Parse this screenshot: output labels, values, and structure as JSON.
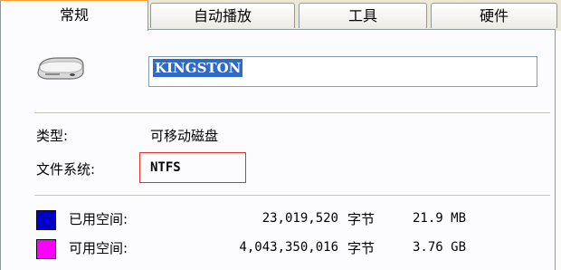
{
  "tabs": [
    {
      "label": "常规",
      "active": true
    },
    {
      "label": "自动播放",
      "active": false
    },
    {
      "label": "工具",
      "active": false
    },
    {
      "label": "硬件",
      "active": false
    }
  ],
  "drive": {
    "icon": "removable-drive-icon",
    "name": "KINGSTON"
  },
  "properties": {
    "type_label": "类型:",
    "type_value": "可移动磁盘",
    "filesystem_label": "文件系统:",
    "filesystem_value": "NTFS"
  },
  "space": {
    "used": {
      "label": "已用空间:",
      "bytes": "23,019,520",
      "unit": "字节",
      "size": "21.9 MB",
      "color": "#0000c8"
    },
    "free": {
      "label": "可用空间:",
      "bytes": "4,043,350,016",
      "unit": "字节",
      "size": "3.76 GB",
      "color": "#ff00ff"
    }
  },
  "colors": {
    "highlight_box": "#e1312f",
    "active_tab_accent": "#ff9f33",
    "selection": "#316ac5"
  }
}
